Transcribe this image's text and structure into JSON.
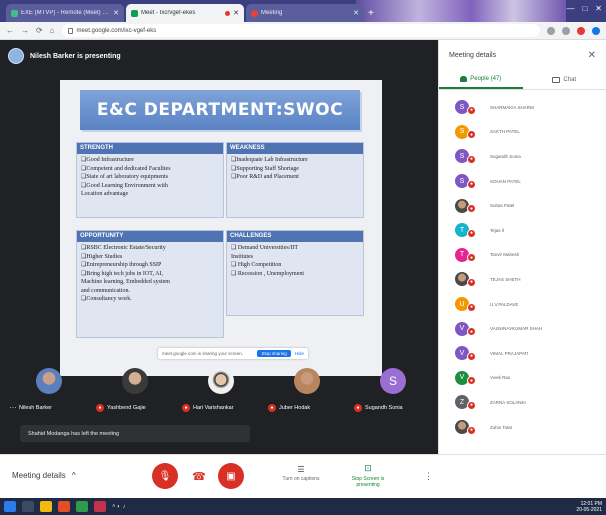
{
  "browser": {
    "tabs": [
      {
        "title": "EXE (MTVP) - Remote (Meet) of (Dept)",
        "favicon": "doc-icon",
        "active": false,
        "recording": false
      },
      {
        "title": "Meet - Ixcrvgef-ekes",
        "favicon": "meet-icon",
        "active": true,
        "recording": true
      },
      {
        "title": "Meeting",
        "favicon": "record-icon",
        "active": false,
        "recording": false
      }
    ],
    "new_tab": "+",
    "window_controls": [
      "—",
      "□",
      "✕"
    ],
    "nav": {
      "back": "←",
      "forward": "→",
      "reload": "⟳",
      "home": "⌂"
    },
    "url": "meet.google.com/ixc-vgef-eks"
  },
  "presenter": {
    "label": "Nilesh Barker is presenting"
  },
  "slide": {
    "title": "E&C DEPARTMENT:SWOC",
    "strengths": {
      "heading": "STRENGTH",
      "items": [
        "Good Infrastructure",
        "Competent and dedicated Faculties",
        "State of art laboratory equipments",
        "Good Learning Environment with",
        "Location advantage"
      ]
    },
    "weakness": {
      "heading": "WEAKNESS",
      "items": [
        "Inadequate Lab Infrastructure",
        "Supporting Staff Shortage",
        "Poor R&D and Placement"
      ]
    },
    "opportunity": {
      "heading": "OPPORTUNITY",
      "items": [
        "RSBC Electronic Estate/Security",
        "Higher Studies",
        "Entrepreneurship through SSIP",
        "Bring high tech jobs in IOT, AI,",
        "Machine learning, Embedded system",
        "and communication.",
        "Consultancy work."
      ]
    },
    "challenges": {
      "heading": "CHALLENGES",
      "items": [
        "Demand Universities/IIT",
        "Institutes",
        "High Competition",
        "Recession , Unemployment"
      ]
    },
    "share_banner": {
      "message": "meet.google.com is sharing your screen.",
      "stop": "Stop sharing",
      "hide": "Hide"
    }
  },
  "participants_strip": [
    {
      "name": "Nilesh Barker",
      "avatar": "photo1",
      "prefix": "more"
    },
    {
      "name": "Yashbend Gajie",
      "avatar": "photo2",
      "prefix": "mic"
    },
    {
      "name": "Hari Varishankar",
      "avatar": "photo3",
      "prefix": "mic"
    },
    {
      "name": "Juber Hodak",
      "avatar": "photo4",
      "prefix": "mic"
    },
    {
      "name": "Sugandh Sonia",
      "avatar": "letter",
      "letter": "S",
      "prefix": "mic"
    }
  ],
  "toast": {
    "text": "Shahid Modanga has left the meeting"
  },
  "panel": {
    "title": "Meeting details",
    "close": "✕",
    "tab_people": "People (47)",
    "tab_chat": "Chat",
    "people": [
      {
        "letter": "S",
        "color": "#7e57c2",
        "name": "SHARMAKIA SHARM"
      },
      {
        "letter": "S",
        "color": "#f29900",
        "name": "SAKTH PATEL"
      },
      {
        "letter": "S",
        "color": "#7e57c2",
        "name": "Sugandh Sonia"
      },
      {
        "letter": "S",
        "color": "#7e57c2",
        "name": "SOHAN PATEL"
      },
      {
        "letter": "",
        "color": "photo",
        "name": "Suhas Patel"
      },
      {
        "letter": "T",
        "color": "#12b5cb",
        "name": "Tejas Il"
      },
      {
        "letter": "T",
        "color": "#e52592",
        "name": "Tanvir Mahesh"
      },
      {
        "letter": "",
        "color": "photo",
        "name": "TEJAS SHETH"
      },
      {
        "letter": "U",
        "color": "#f29900",
        "name": "U.V.PALDAVE"
      },
      {
        "letter": "V",
        "color": "#7e57c2",
        "name": "VAISHNAVKUMAR SHAH"
      },
      {
        "letter": "V",
        "color": "#7e57c2",
        "name": "VIMAL PRAJAPATI"
      },
      {
        "letter": "V",
        "color": "#1e8e3e",
        "name": "Vivek Rao"
      },
      {
        "letter": "Z",
        "color": "#5f6368",
        "name": "ZARNA SOLANKI"
      },
      {
        "letter": "",
        "color": "photo",
        "name": "Zubin Tolat"
      }
    ]
  },
  "controls": {
    "meeting_details": "Meeting details",
    "caret": "^",
    "captions_label": "Turn on captions",
    "captions_glyph": "☰",
    "share_label": "Stop Screen is presenting",
    "share_glyph": "⊡",
    "more": "⋮"
  },
  "taskbar": {
    "time": "12:01 PM",
    "date": "20-05-2021"
  }
}
